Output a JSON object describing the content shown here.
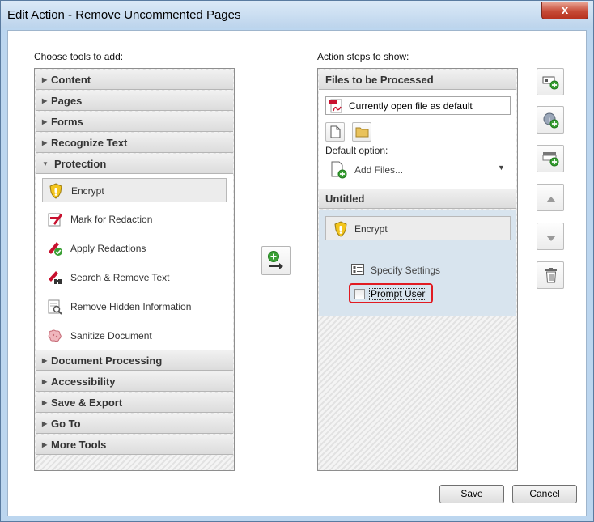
{
  "window": {
    "title": "Edit Action - Remove Uncommented Pages",
    "close_glyph": "x"
  },
  "left": {
    "label": "Choose tools to add:",
    "categories_top": [
      {
        "label": "Content",
        "expanded": false
      },
      {
        "label": "Pages",
        "expanded": false
      },
      {
        "label": "Forms",
        "expanded": false
      },
      {
        "label": "Recognize Text",
        "expanded": false
      },
      {
        "label": "Protection",
        "expanded": true
      }
    ],
    "tools": [
      {
        "label": "Encrypt",
        "icon": "encrypt-shield-icon",
        "selected": true
      },
      {
        "label": "Mark for Redaction",
        "icon": "mark-redaction-icon",
        "selected": false
      },
      {
        "label": "Apply Redactions",
        "icon": "apply-redactions-icon",
        "selected": false
      },
      {
        "label": "Search & Remove Text",
        "icon": "search-remove-text-icon",
        "selected": false
      },
      {
        "label": "Remove Hidden Information",
        "icon": "remove-hidden-info-icon",
        "selected": false
      },
      {
        "label": "Sanitize Document",
        "icon": "sanitize-document-icon",
        "selected": false
      }
    ],
    "categories_bottom": [
      {
        "label": "Document Processing",
        "expanded": false
      },
      {
        "label": "Accessibility",
        "expanded": false
      },
      {
        "label": "Save & Export",
        "expanded": false
      },
      {
        "label": "Go To",
        "expanded": false
      },
      {
        "label": "More Tools",
        "expanded": false
      }
    ]
  },
  "right": {
    "label": "Action steps to show:",
    "files_header": "Files to be Processed",
    "file_value": "Currently open file as default",
    "default_option_label": "Default option:",
    "add_files_label": "Add Files...",
    "group_title": "Untitled",
    "step_label": "Encrypt",
    "specify_label": "Specify Settings",
    "prompt_label": "Prompt User",
    "prompt_checked": false
  },
  "buttons": {
    "save": "Save",
    "cancel": "Cancel"
  },
  "colors": {
    "highlight_border": "#e11b22",
    "shield_yellow": "#f3c51d",
    "pdf_red": "#c8102e",
    "add_green": "#3aa035"
  }
}
